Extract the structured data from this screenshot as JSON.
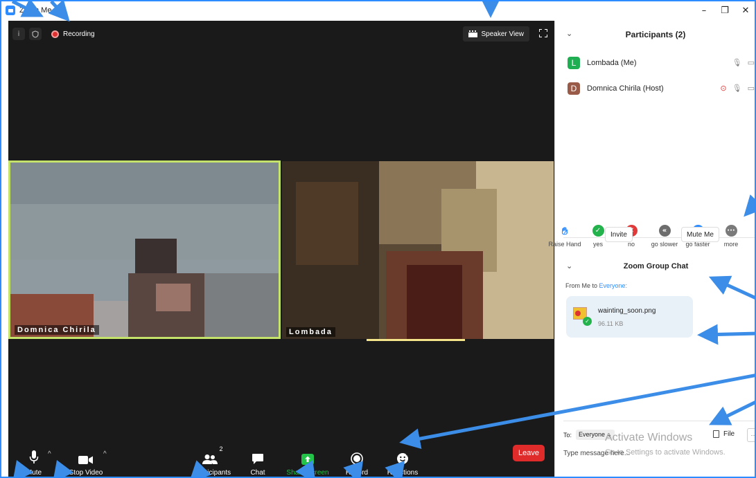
{
  "window": {
    "title": "Zoom Me",
    "minimize": "–",
    "restore": "❐",
    "close": "✕"
  },
  "meeting": {
    "info_icon": "info-icon",
    "shield_icon": "shield-icon",
    "recording_label": "Recording",
    "speaker_view_label": "Speaker View",
    "tiles": [
      {
        "name": "Domnica Chirila",
        "active_speaker": true
      },
      {
        "name": "Lombada",
        "active_speaker": false
      }
    ]
  },
  "toolbar": {
    "mute": "Mute",
    "stop_video": "Stop Video",
    "participants": "Participants",
    "participants_count": "2",
    "chat": "Chat",
    "share_screen": "Share Screen",
    "record": "Record",
    "reactions": "Reactions",
    "leave": "Leave"
  },
  "participants_panel": {
    "title": "Participants (2)",
    "list": [
      {
        "initial": "L",
        "name": "Lombada (Me)",
        "color": "#1fae52"
      },
      {
        "initial": "D",
        "name": "Domnica Chirila (Host)",
        "color": "#9a5a48"
      }
    ],
    "reactions": [
      {
        "label": "Raise Hand",
        "symbol": "✋",
        "color": "#2d8cff"
      },
      {
        "label": "yes",
        "symbol": "✓",
        "color": "#23b24b"
      },
      {
        "label": "no",
        "symbol": "✕",
        "color": "#e03a3a"
      },
      {
        "label": "go slower",
        "symbol": "«",
        "color": "#6d6d6d"
      },
      {
        "label": "go faster",
        "symbol": "»",
        "color": "#2d8cff"
      },
      {
        "label": "more",
        "symbol": "···",
        "color": "#7a7a7a"
      }
    ],
    "invite": "Invite",
    "mute_me": "Mute Me"
  },
  "chat_panel": {
    "title": "Zoom Group Chat",
    "from_prefix": "From Me to ",
    "from_target": "Everyone:",
    "file_name": "wainting_soon.png",
    "file_size": "96.11 KB",
    "to_label": "To:",
    "to_value": "Everyone",
    "file_button": "File",
    "more_button": "···",
    "placeholder": "Type message here..."
  },
  "watermark": {
    "line1": "Activate Windows",
    "line2": "Go to Settings to activate Windows."
  },
  "colors": {
    "accent": "#2d8cff",
    "leave": "#e02b2b",
    "share": "#23c249",
    "speaker_border": "#c5e36a"
  }
}
